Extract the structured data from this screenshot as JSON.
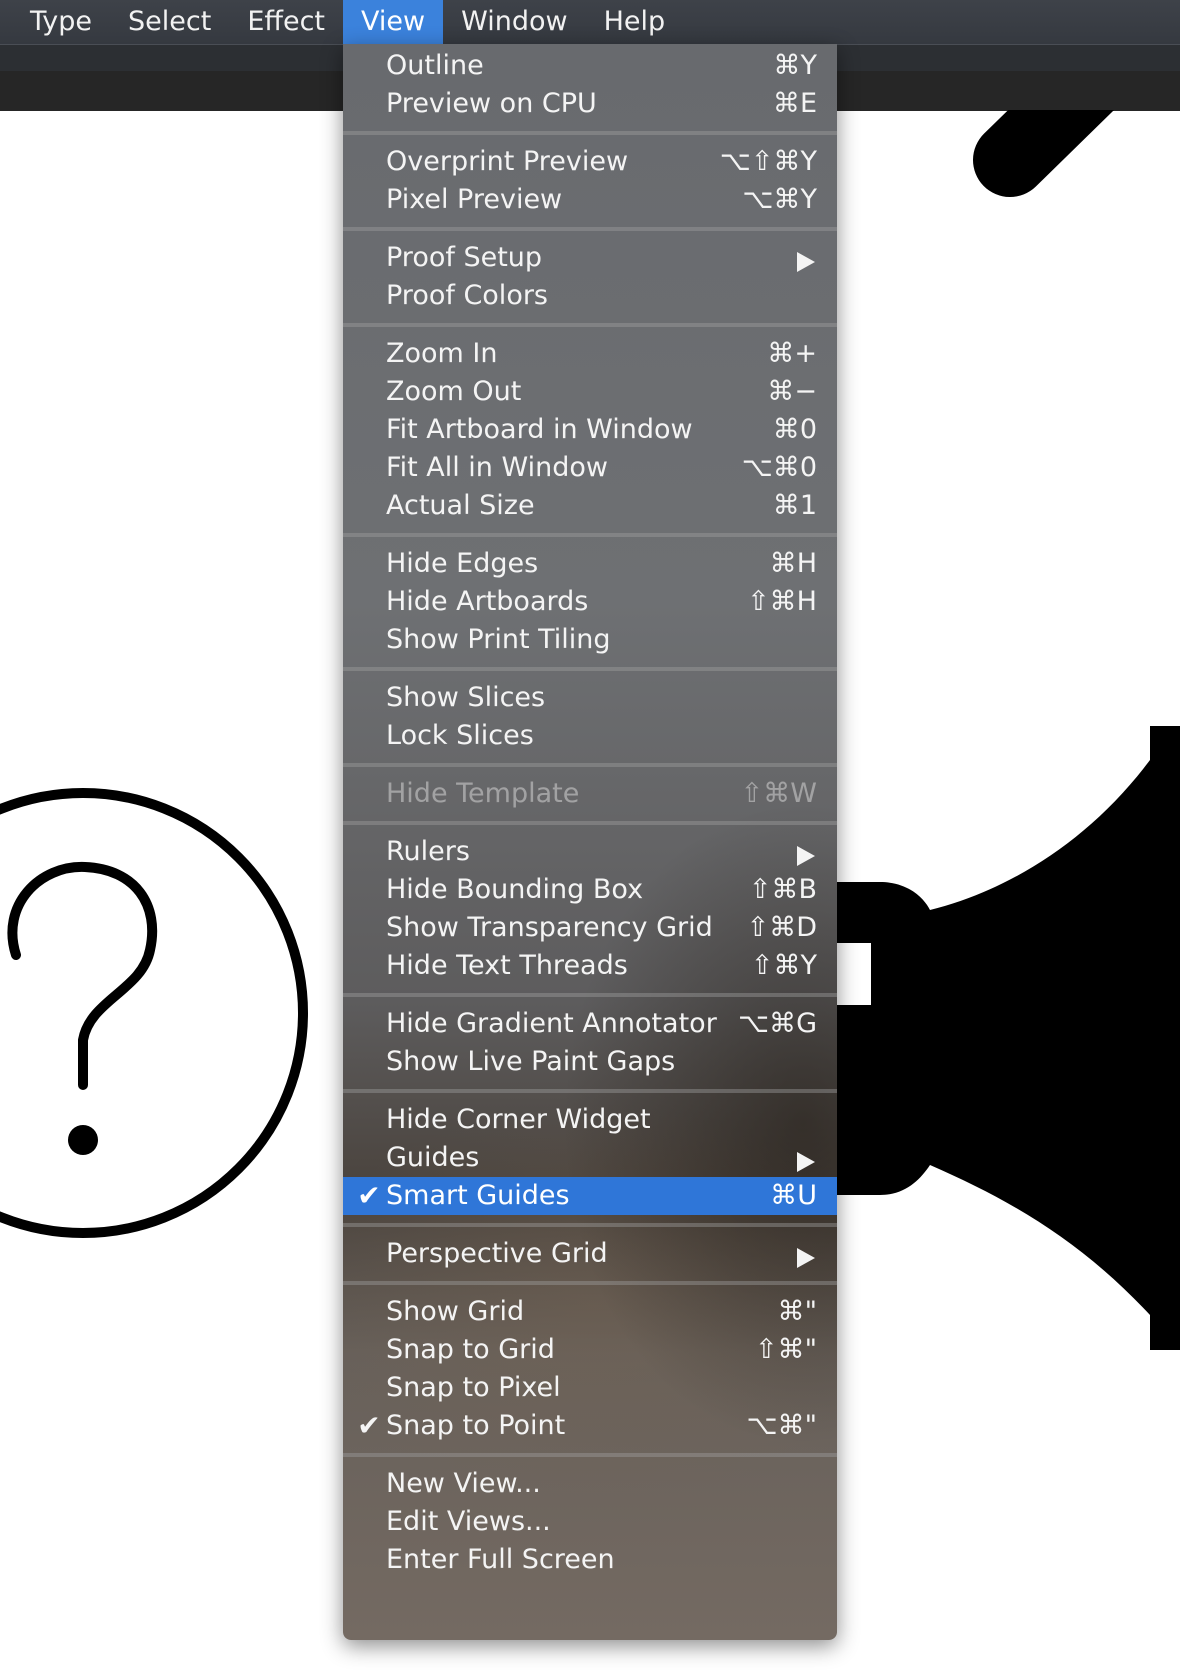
{
  "menubar": {
    "items": [
      {
        "label": "Type",
        "active": false
      },
      {
        "label": "Select",
        "active": false
      },
      {
        "label": "Effect",
        "active": false
      },
      {
        "label": "View",
        "active": true
      },
      {
        "label": "Window",
        "active": false
      },
      {
        "label": "Help",
        "active": false
      }
    ]
  },
  "colors": {
    "menubar_bg": "#393d44",
    "active_menu": "#3b82dc",
    "highlight": "#2f76d8",
    "menu_text": "#f4f4f4"
  },
  "view_menu": {
    "groups": [
      [
        {
          "label": "Outline",
          "shortcut": "⌘Y"
        },
        {
          "label": "Preview on CPU",
          "shortcut": "⌘E"
        }
      ],
      [
        {
          "label": "Overprint Preview",
          "shortcut": "⌥⇧⌘Y"
        },
        {
          "label": "Pixel Preview",
          "shortcut": "⌥⌘Y"
        }
      ],
      [
        {
          "label": "Proof Setup",
          "shortcut": "",
          "submenu": true
        },
        {
          "label": "Proof Colors",
          "shortcut": ""
        }
      ],
      [
        {
          "label": "Zoom In",
          "shortcut": "⌘+"
        },
        {
          "label": "Zoom Out",
          "shortcut": "⌘−"
        },
        {
          "label": "Fit Artboard in Window",
          "shortcut": "⌘0"
        },
        {
          "label": "Fit All in Window",
          "shortcut": "⌥⌘0"
        },
        {
          "label": "Actual Size",
          "shortcut": "⌘1"
        }
      ],
      [
        {
          "label": "Hide Edges",
          "shortcut": "⌘H"
        },
        {
          "label": "Hide Artboards",
          "shortcut": "⇧⌘H"
        },
        {
          "label": "Show Print Tiling",
          "shortcut": ""
        }
      ],
      [
        {
          "label": "Show Slices",
          "shortcut": ""
        },
        {
          "label": "Lock Slices",
          "shortcut": ""
        }
      ],
      [
        {
          "label": "Hide Template",
          "shortcut": "⇧⌘W",
          "disabled": true
        }
      ],
      [
        {
          "label": "Rulers",
          "shortcut": "",
          "submenu": true
        },
        {
          "label": "Hide Bounding Box",
          "shortcut": "⇧⌘B"
        },
        {
          "label": "Show Transparency Grid",
          "shortcut": "⇧⌘D"
        },
        {
          "label": "Hide Text Threads",
          "shortcut": "⇧⌘Y"
        }
      ],
      [
        {
          "label": "Hide Gradient Annotator",
          "shortcut": "⌥⌘G"
        },
        {
          "label": "Show Live Paint Gaps",
          "shortcut": ""
        }
      ],
      [
        {
          "label": "Hide Corner Widget",
          "shortcut": ""
        },
        {
          "label": "Guides",
          "shortcut": "",
          "submenu": true
        },
        {
          "label": "Smart Guides",
          "shortcut": "⌘U",
          "checked": true,
          "highlighted": true
        }
      ],
      [
        {
          "label": "Perspective Grid",
          "shortcut": "",
          "submenu": true
        }
      ],
      [
        {
          "label": "Show Grid",
          "shortcut": "⌘\""
        },
        {
          "label": "Snap to Grid",
          "shortcut": "⇧⌘\""
        },
        {
          "label": "Snap to Pixel",
          "shortcut": ""
        },
        {
          "label": "Snap to Point",
          "shortcut": "⌥⌘\"",
          "checked": true
        }
      ],
      [
        {
          "label": "New View...",
          "shortcut": ""
        },
        {
          "label": "Edit Views...",
          "shortcut": ""
        },
        {
          "label": "Enter Full Screen",
          "shortcut": ""
        }
      ]
    ]
  },
  "canvas": {
    "icons": [
      "pen-stroke-shape",
      "question-circle-icon",
      "megaphone-icon"
    ]
  }
}
